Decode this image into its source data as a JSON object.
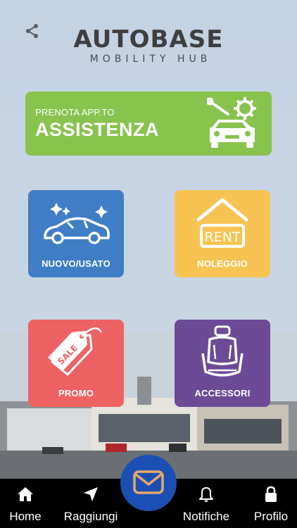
{
  "header": {
    "logo_main": "AUTOBASE",
    "logo_sub": "MOBILITY HUB",
    "share_icon": "share-icon"
  },
  "tiles": {
    "assistenza": {
      "small": "PRENOTA APP.TO",
      "big": "ASSISTENZA",
      "icon": "car-service-icon",
      "color": "#88c34e"
    },
    "nuovo": {
      "label": "NUOVO/USATO",
      "icon": "sparkling-car-icon",
      "color": "#3f7ec5"
    },
    "noleggio": {
      "label": "NOLEGGIO",
      "icon": "rent-house-icon",
      "icon_text": "RENT",
      "color": "#f7c453"
    },
    "promo": {
      "label": "PROMO",
      "icon": "sale-tag-icon",
      "icon_text": "SALE",
      "color": "#ee6264"
    },
    "accessori": {
      "label": "ACCESSORI",
      "icon": "car-seat-icon",
      "color": "#6c4a96"
    }
  },
  "tabbar": {
    "home": "Home",
    "raggiungi": "Raggiungi",
    "notifiche": "Notifiche",
    "profilo": "Profilo",
    "fab_icon": "mail-icon",
    "fab_color": "#1c4fb4"
  }
}
